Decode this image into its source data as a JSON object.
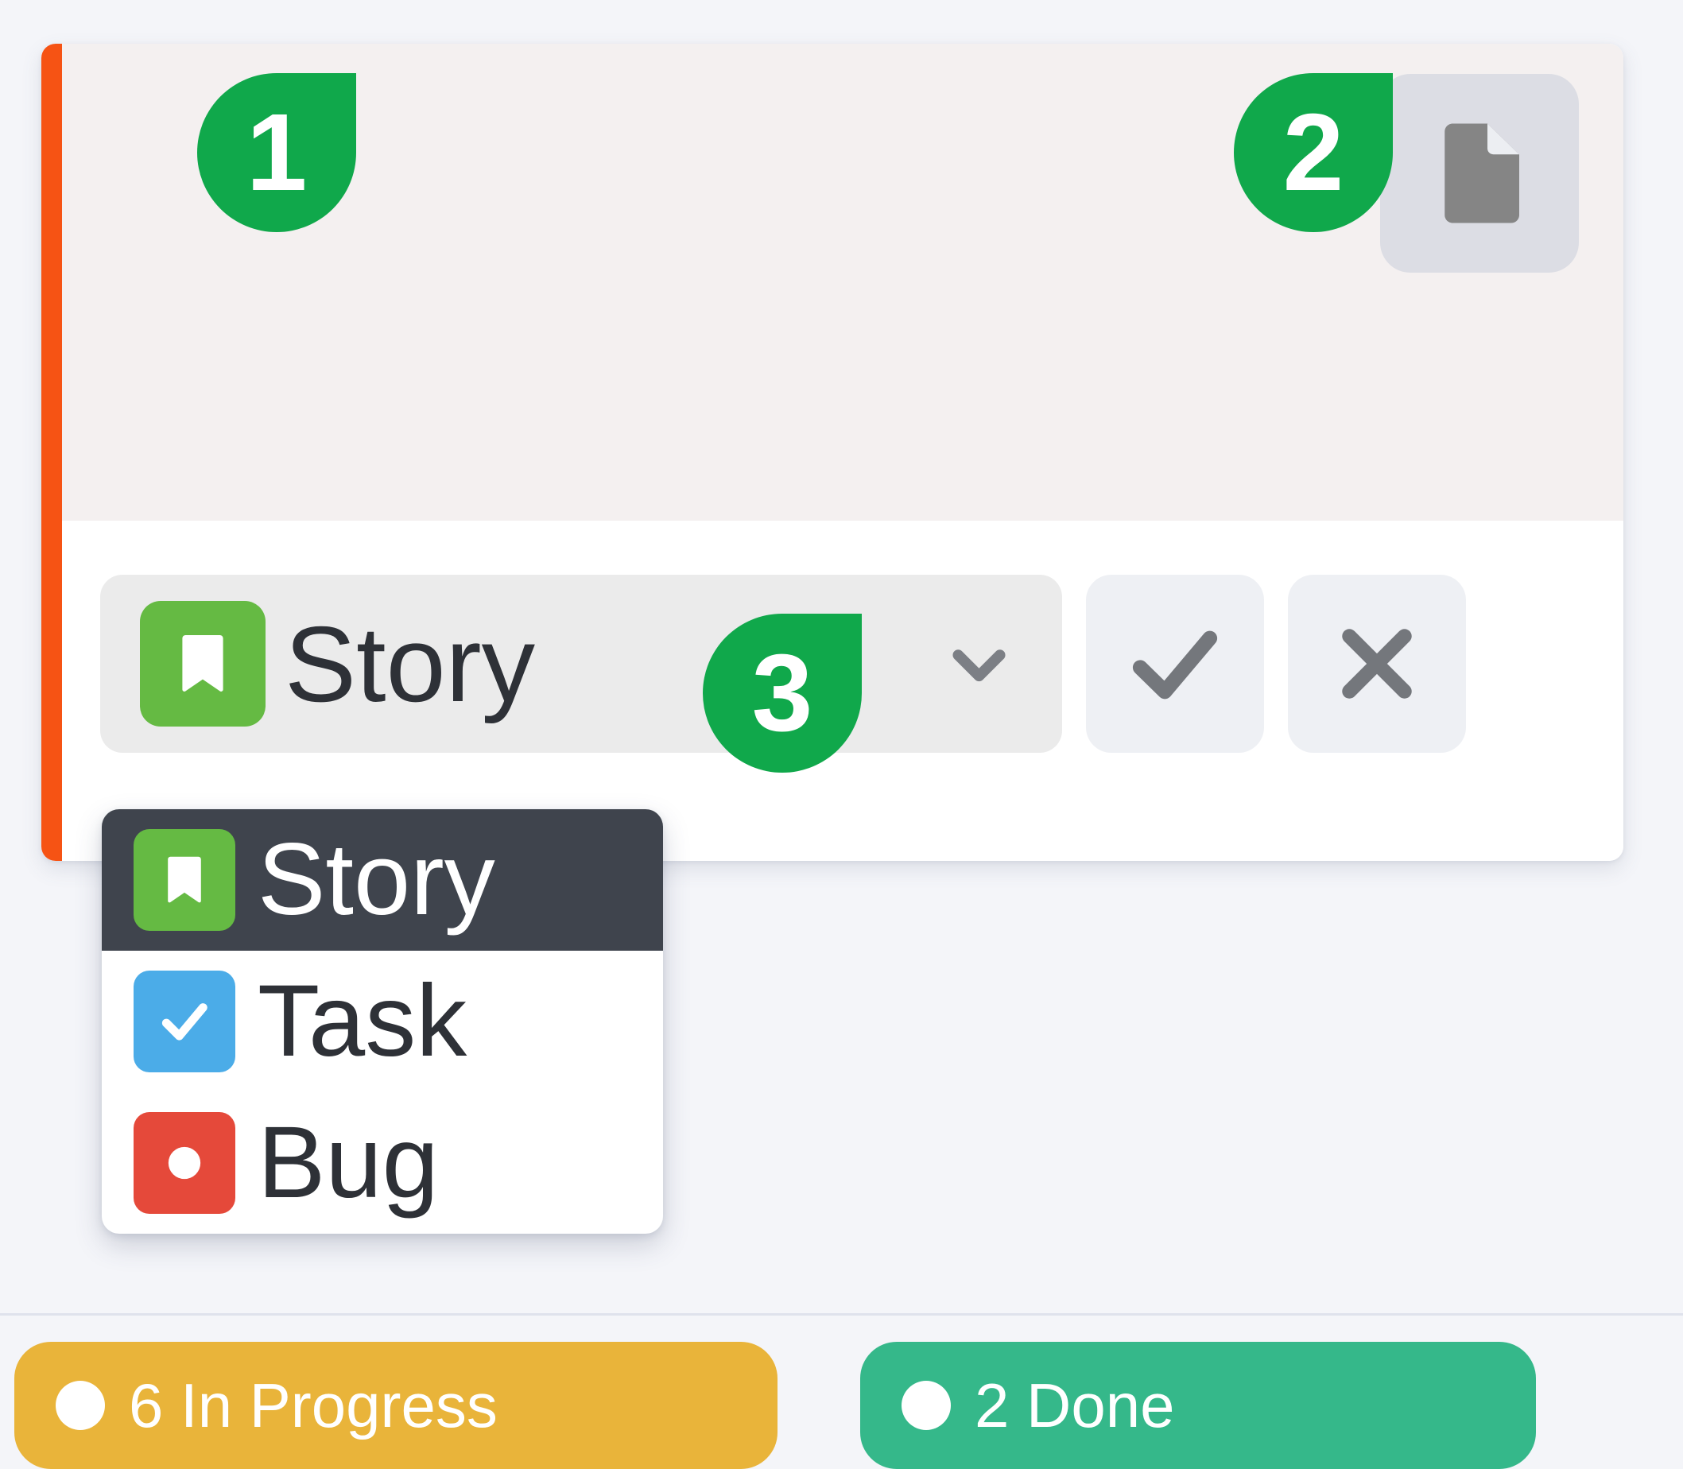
{
  "card": {
    "accent_color": "#f65314",
    "header_bg": "#f4f0f0",
    "attachment_icon": "document-icon"
  },
  "type_selector": {
    "selected_label": "Story",
    "selected_icon": "bookmark-icon",
    "selected_icon_color": "#65ba43",
    "chevron_icon": "chevron-down-icon",
    "confirm_icon": "check-icon",
    "cancel_icon": "close-icon"
  },
  "dropdown": {
    "options": [
      {
        "label": "Story",
        "icon": "bookmark-icon",
        "icon_color": "#65ba43",
        "selected": true
      },
      {
        "label": "Task",
        "icon": "check-square-icon",
        "icon_color": "#4bace8",
        "selected": false
      },
      {
        "label": "Bug",
        "icon": "circle-dot-icon",
        "icon_color": "#e5493a",
        "selected": false
      }
    ]
  },
  "badges": [
    {
      "number": "1",
      "color": "#10a84b"
    },
    {
      "number": "2",
      "color": "#10a84b"
    },
    {
      "number": "3",
      "color": "#10a84b"
    }
  ],
  "status_bar": {
    "pills": [
      {
        "count": "6",
        "label": "In Progress",
        "text": "6 In Progress",
        "color": "#e9b43a"
      },
      {
        "count": "2",
        "label": "Done",
        "text": "2 Done",
        "color": "#35b88a"
      }
    ]
  }
}
